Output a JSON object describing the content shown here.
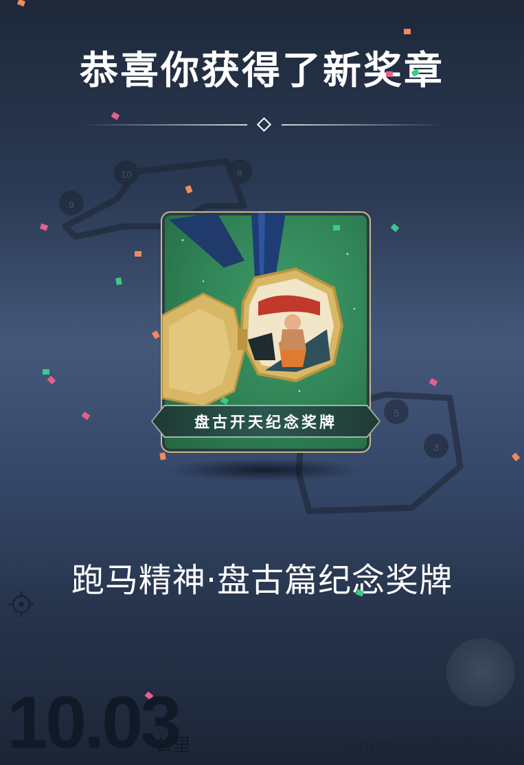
{
  "header": {
    "title": "恭喜你获得了新奖章"
  },
  "medal": {
    "banner_text": "盘古开天纪念奖牌"
  },
  "medal_name": "跑马精神·盘古篇纪念奖牌",
  "stats": {
    "distance": "10.03",
    "unit": "公里"
  },
  "footer": {
    "user": "Agile扬长避短等贵人"
  },
  "map_markers": [
    "10",
    "8",
    "9",
    "5",
    "3"
  ],
  "colors": {
    "confetti_orange": "#f08a5d",
    "confetti_pink": "#e95f8c",
    "confetti_green": "#3cc98a",
    "medal_green": "#2f8154",
    "gold": "#d8b866"
  }
}
